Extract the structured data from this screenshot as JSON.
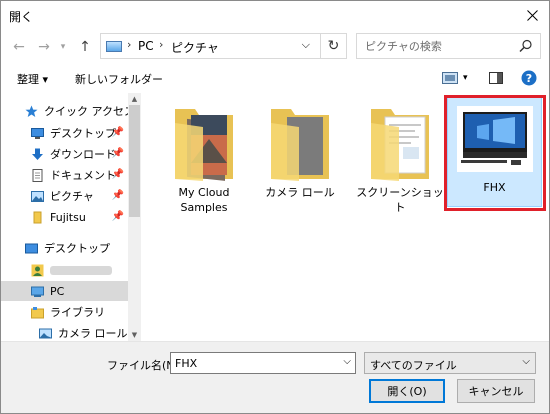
{
  "title": "開く",
  "nav": {
    "path": [
      "PC",
      "ピクチャ"
    ],
    "search_placeholder": "ピクチャの検索"
  },
  "toolbar": {
    "organize": "整理 ▾",
    "new_folder": "新しいフォルダー"
  },
  "tree": {
    "quick_access": "クイック アクセス",
    "items": [
      {
        "label": "デスクトップ",
        "pinned": true
      },
      {
        "label": "ダウンロード",
        "pinned": true
      },
      {
        "label": "ドキュメント",
        "pinned": true
      },
      {
        "label": "ピクチャ",
        "pinned": true
      },
      {
        "label": "Fujitsu",
        "pinned": true
      }
    ],
    "desktop": "デスクトップ",
    "pc": "PC",
    "library": "ライブラリ",
    "camera_roll": "カメラ ロール"
  },
  "files": [
    {
      "label_line1": "My Cloud",
      "label_line2": "Samples"
    },
    {
      "label_line1": "カメラ ロール",
      "label_line2": ""
    },
    {
      "label_line1": "スクリーンショット",
      "label_line2": ""
    },
    {
      "label_line1": "FHX",
      "label_line2": ""
    }
  ],
  "bottom": {
    "filename_label": "ファイル名(N):",
    "filename_value": "FHX",
    "filetype": "すべてのファイル",
    "open_label": "開く(O)",
    "cancel_label": "キャンセル"
  }
}
